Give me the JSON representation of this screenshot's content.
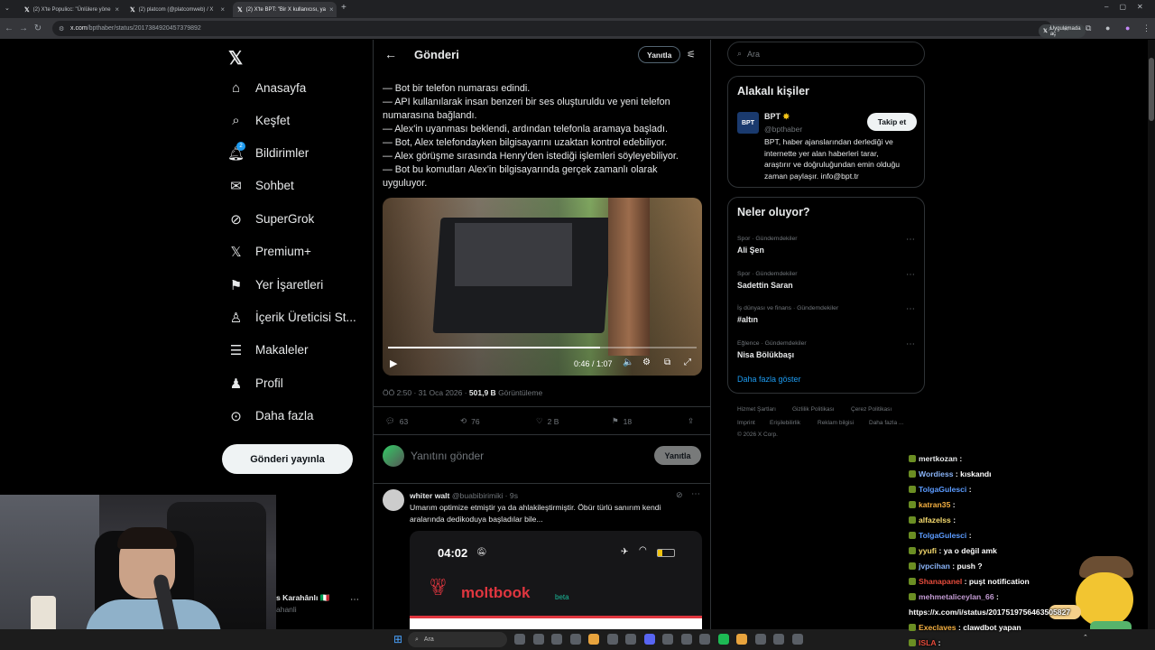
{
  "browser": {
    "tabs": [
      {
        "label": "(2) X'te Populicc: \"Ünlülere yöne",
        "active": false
      },
      {
        "label": "(2) platcom (@platcomweb) / X",
        "active": false
      },
      {
        "label": "(2) X'te BPT: \"Bir X kullanıcısı, ya",
        "active": true
      }
    ],
    "url_host": "x.com",
    "url_path": "/bpthaber/status/2017384920457379892",
    "open_in_app": "Uygulamada aç"
  },
  "nav": {
    "items": [
      {
        "label": "Anasayfa",
        "icon": "home-icon"
      },
      {
        "label": "Keşfet",
        "icon": "search-icon"
      },
      {
        "label": "Bildirimler",
        "icon": "bell-icon",
        "badge": "2"
      },
      {
        "label": "Sohbet",
        "icon": "mail-icon"
      },
      {
        "label": "SuperGrok",
        "icon": "grok-icon"
      },
      {
        "label": "Premium+",
        "icon": "x-logo-icon"
      },
      {
        "label": "Yer İşaretleri",
        "icon": "bookmark-icon"
      },
      {
        "label": "İçerik Üreticisi St...",
        "icon": "creator-icon"
      },
      {
        "label": "Makaleler",
        "icon": "article-icon"
      },
      {
        "label": "Profil",
        "icon": "person-icon"
      },
      {
        "label": "Daha fazla",
        "icon": "more-circle-icon"
      }
    ],
    "post_button": "Gönderi yayınla",
    "account_name": "s Karahânlı 🇮🇹",
    "account_handle": "ahanli"
  },
  "post": {
    "header_title": "Gönderi",
    "reply_pill": "Yanıtla",
    "lines": [
      "— Bot bir telefon numarası edindi.",
      "— API kullanılarak insan benzeri bir ses oluşturuldu ve yeni telefon",
      "numarasına bağlandı.",
      "— Alex'in uyanması beklendi, ardından telefonla aramaya başladı.",
      "— Bot, Alex telefondayken bilgisayarını uzaktan kontrol edebiliyor.",
      "— Alex görüşme sırasında Henry'den istediği işlemleri söyleyebiliyor.",
      "— Bot bu komutları Alex'in bilgisayarında gerçek zamanlı olarak",
      "uyguluyor."
    ],
    "video": {
      "time": "0:46 / 1:07",
      "progress": 0.687
    },
    "meta_time": "ÖÖ 2:50 · 31 Oca 2026 · ",
    "views_value": "501,9 B",
    "views_label": " Görüntüleme",
    "actions": {
      "replies": "63",
      "reposts": "76",
      "likes": "2 B",
      "bookmarks": "18"
    },
    "reply_placeholder": "Yanıtını gönder",
    "reply_button": "Yanıtla"
  },
  "reply": {
    "name": "whiter walt",
    "handle": "@buabibirimiki · 9s",
    "line1": "Umarım optimize etmiştir ya da ahlakileştirmiştir. Öbür türlü sanırım kendi",
    "line2": "aralarında dedikoduya başladılar bile...",
    "phone_time": "04:02",
    "brand": "moltbook",
    "brand_suffix": "beta"
  },
  "right": {
    "search_placeholder": "Ara",
    "related_title": "Alakalı kişiler",
    "person": {
      "name": "BPT",
      "handle": "@bpthaber",
      "follow": "Takip et",
      "bio": [
        "BPT, haber ajanslarından derlediği ve",
        "internette yer alan haberleri tarar,",
        "araştırır ve doğruluğundan emin olduğu",
        "zaman paylaşır. info@bpt.tr"
      ]
    },
    "trends_title": "Neler oluyor?",
    "trends": [
      {
        "category": "Spor · Gündemdekiler",
        "name": "Ali Şen"
      },
      {
        "category": "Spor · Gündemdekiler",
        "name": "Sadettin Saran"
      },
      {
        "category": "İş dünyası ve finans · Gündemdekiler",
        "name": "#altın"
      },
      {
        "category": "Eğlence · Gündemdekiler",
        "name": "Nisa Bölükbaşı"
      }
    ],
    "show_more": "Daha fazla göster",
    "footer": [
      "Hizmet Şartları",
      "Gizlilik Politikası",
      "Çerez Politikası",
      "Imprint",
      "Erişilebilirlik",
      "Reklam bilgisi",
      "Daha fazla ...",
      "© 2026 X Corp."
    ]
  },
  "chat": [
    {
      "user": "mertkozan",
      "text": " : ",
      "color": "#e7e9ea"
    },
    {
      "user": "Wordiess",
      "text": " : kıskandı",
      "color": "#8ab4f8"
    },
    {
      "user": "TolgaGulesci",
      "text": " : ",
      "color": "#5b9bff"
    },
    {
      "user": "katran35",
      "text": " : ",
      "color": "#f5b041"
    },
    {
      "user": "alfazelss",
      "text": " : ",
      "color": "#f7dc6f"
    },
    {
      "user": "TolgaGulesci",
      "text": " : ",
      "color": "#5b9bff"
    },
    {
      "user": "yyufi",
      "text": " : ya o değil amk",
      "color": "#f7dc6f"
    },
    {
      "user": "jvpcihan",
      "text": " : push ?",
      "color": "#8ab4f8"
    },
    {
      "user": "Shanapanel",
      "text": " : puşt notification",
      "color": "#e74c3c"
    },
    {
      "user": "mehmetaliceylan_66",
      "text": " :",
      "color": "#c39bd3"
    },
    {
      "user": "",
      "text": "https://x.com/i/status/2017519756463505827",
      "color": "#ffffff"
    },
    {
      "user": "Execlaves",
      "text": " : clawdbot yapan",
      "color": "#f5b041"
    },
    {
      "user": "ISLA",
      "text": " : ",
      "color": "#e74c3c"
    }
  ],
  "taskbar": {
    "search": "Ara"
  },
  "colors": {
    "accent": "#1d9bf0",
    "bg": "#000000",
    "border": "#2f3336",
    "muted": "#71767b"
  }
}
